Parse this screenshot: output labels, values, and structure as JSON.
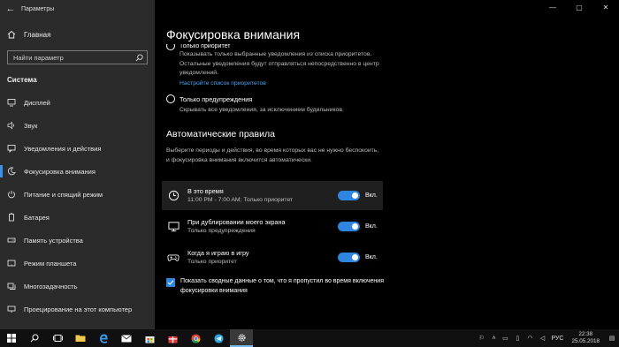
{
  "window": {
    "title": "Параметры",
    "controls": [
      "—",
      "▢",
      "✕"
    ]
  },
  "sidebar": {
    "home_label": "Главная",
    "search_placeholder": "Найти параметр",
    "section": "Система",
    "items": [
      {
        "label": "Дисплей",
        "icon": "display-icon"
      },
      {
        "label": "Звук",
        "icon": "sound-icon"
      },
      {
        "label": "Уведомления и действия",
        "icon": "notifications-icon"
      },
      {
        "label": "Фокусировка внимания",
        "icon": "focus-assist-icon",
        "active": true
      },
      {
        "label": "Питание и спящий режим",
        "icon": "power-icon"
      },
      {
        "label": "Батарея",
        "icon": "battery-icon"
      },
      {
        "label": "Память устройства",
        "icon": "storage-icon"
      },
      {
        "label": "Режим планшета",
        "icon": "tablet-icon"
      },
      {
        "label": "Многозадачность",
        "icon": "multitasking-icon"
      },
      {
        "label": "Проецирование на этот компьютер",
        "icon": "projecting-icon"
      }
    ]
  },
  "main": {
    "title": "Фокусировка внимания",
    "priority_only": {
      "label": "Только приоритет",
      "desc": "Показывать только выбранные уведомления из списка приоритетов. Остальные уведомления будут отправляться непосредственно в центр уведомлений.",
      "link": "Настройте список приоритетов"
    },
    "alarms_only": {
      "label": "Только предупреждения",
      "desc": "Скрывать все уведомления, за исключением будильников."
    },
    "auto_rules": {
      "title": "Автоматические правила",
      "desc": "Выберите периоды и действия, во время которых вас не нужно беспокоить, и фокусировка внимания включится автоматически.",
      "rules": [
        {
          "name": "В это время",
          "sub": "11:00 PM - 7:00 AM; Только приоритет",
          "state": "Вкл.",
          "icon": "clock-icon"
        },
        {
          "name": "При дублировании моего экрана",
          "sub": "Только предупреждения",
          "state": "Вкл.",
          "icon": "monitor-icon"
        },
        {
          "name": "Когда я играю в игру",
          "sub": "Только приоритет",
          "state": "Вкл.",
          "icon": "gamepad-icon"
        }
      ]
    },
    "summary_checkbox": "Показать сводные данные о том, что я пропустил во время включения фокусировки внимания"
  },
  "taskbar": {
    "tray": {
      "lang": "РУС",
      "time": "22:38",
      "date": "25.05.2018"
    }
  },
  "colors": {
    "accent": "#2f86e0",
    "link": "#4aa3f5",
    "sidebar_bg": "#2b2b2b"
  }
}
